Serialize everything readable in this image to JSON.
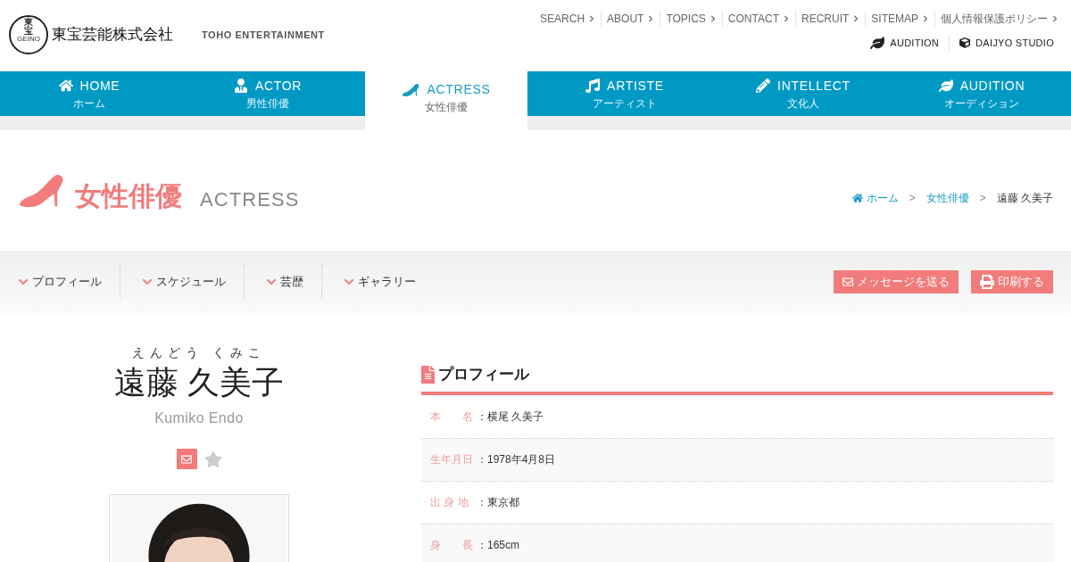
{
  "logo": {
    "mark_top": "東",
    "mark_bottom": "宝",
    "mark_ring": "GEINO",
    "name": "東宝芸能株式会社",
    "english": "TOHO ENTERTAINMENT"
  },
  "utility_links": [
    {
      "label": "SEARCH"
    },
    {
      "label": "ABOUT"
    },
    {
      "label": "TOPICS"
    },
    {
      "label": "CONTACT"
    },
    {
      "label": "RECRUIT"
    },
    {
      "label": "SITEMAP"
    },
    {
      "label": "個人情報保護ポリシー"
    }
  ],
  "utility_buttons": [
    {
      "label": "AUDITION"
    },
    {
      "label": "DAIJYO STUDIO"
    }
  ],
  "nav_tabs": [
    {
      "label": "HOME",
      "sub": "ホーム",
      "selected": false
    },
    {
      "label": "ACTOR",
      "sub": "男性俳優",
      "selected": false
    },
    {
      "label": "ACTRESS",
      "sub": "女性俳優",
      "selected": true
    },
    {
      "label": "ARTISTE",
      "sub": "アーティスト",
      "selected": false
    },
    {
      "label": "INTELLECT",
      "sub": "文化人",
      "selected": false
    },
    {
      "label": "AUDITION",
      "sub": "オーディション",
      "selected": false
    }
  ],
  "page_title": {
    "japanese": "女性俳優",
    "english": "ACTRESS"
  },
  "breadcrumb": [
    {
      "label": "ホーム",
      "kind": "home"
    },
    {
      "label": ">",
      "kind": "sep"
    },
    {
      "label": "女性俳優",
      "kind": "link"
    },
    {
      "label": ">",
      "kind": "sep"
    },
    {
      "label": "遠藤 久美子",
      "kind": "current"
    }
  ],
  "section_tabs": [
    {
      "label": "プロフィール"
    },
    {
      "label": "スケジュール"
    },
    {
      "label": "芸歴"
    },
    {
      "label": "ギャラリー"
    }
  ],
  "actions": [
    {
      "label": "メッセージを送る"
    },
    {
      "label": "印刷する"
    }
  ],
  "profile": {
    "reading": "えんどう くみこ",
    "name": "遠藤 久美子",
    "romaji": "Kumiko Endo",
    "favorite": false
  },
  "details": {
    "heading": "プロフィール",
    "rows": [
      {
        "label": "本　　名",
        "sep": "：",
        "value": "横尾 久美子"
      },
      {
        "label": "生年月日",
        "sep": "：",
        "value": "1978年4月8日"
      },
      {
        "label": "出 身 地",
        "sep": "：",
        "value": "東京都"
      },
      {
        "label": "身　　長",
        "sep": "：",
        "value": "165cm"
      }
    ]
  }
}
